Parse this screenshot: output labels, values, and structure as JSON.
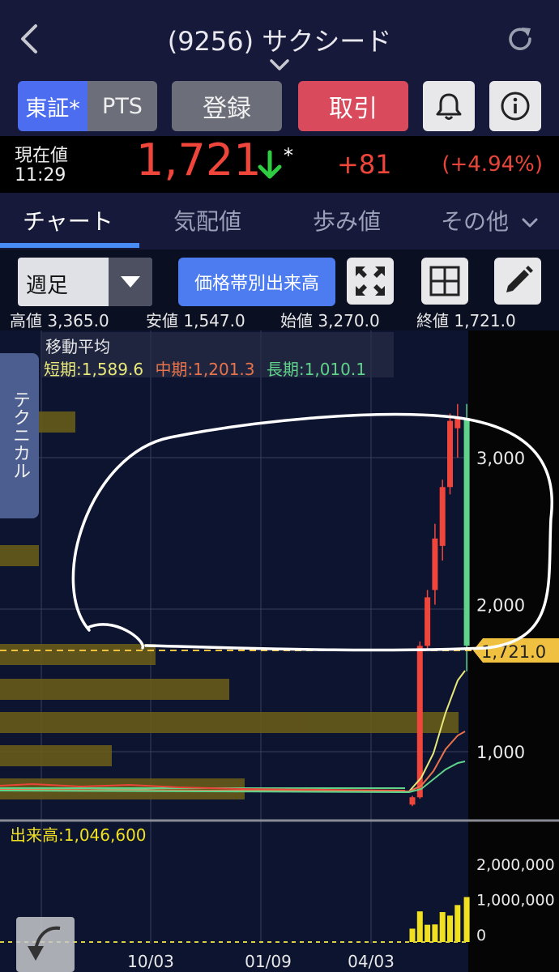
{
  "header": {
    "title": "(9256) サクシード"
  },
  "toolbar": {
    "market_tosho": "東証*",
    "market_pts": "PTS",
    "register": "登録",
    "trade": "取引"
  },
  "price": {
    "label": "現在値",
    "time": "11:29",
    "value": "1,721",
    "star": "*",
    "change": "+81",
    "change_pct": "(+4.94%)",
    "down_color": "#2ecc40",
    "up_color": "#f0453a"
  },
  "tabs": [
    {
      "label": "チャート",
      "active": true
    },
    {
      "label": "気配値"
    },
    {
      "label": "歩み値"
    },
    {
      "label": "その他"
    }
  ],
  "controls": {
    "period": "週足",
    "volume_profile": "価格帯別出来高"
  },
  "ohlc": {
    "high": "高値 3,365.0",
    "low": "安値 1,547.0",
    "open": "始値 3,270.0",
    "close": "終値 1,721.0"
  },
  "moving_average": {
    "title": "移動平均",
    "short": "短期:1,589.6",
    "mid": "中期:1,201.3",
    "long": "長期:1,010.1",
    "short_color": "#e8e87a",
    "mid_color": "#e8734a",
    "long_color": "#5fd38a"
  },
  "technical_tab": "テクニカル",
  "chart_data": {
    "type": "candlestick",
    "price_axis": {
      "ticks": [
        {
          "value": 3000,
          "label": "3,000"
        },
        {
          "value": 2000,
          "label": "2,000"
        },
        {
          "value": 1000,
          "label": "1,000"
        }
      ]
    },
    "current_price_label": "1,721.0",
    "current_price": 1721,
    "volume_label": "出来高:1,046,600",
    "volume_axis": {
      "ticks": [
        {
          "value": 2000000,
          "label": "2,000,000"
        },
        {
          "value": 1000000,
          "label": "1,000,000"
        },
        {
          "value": 0,
          "label": "0"
        }
      ]
    },
    "x_ticks": [
      "10/03",
      "01/09",
      "04/03"
    ],
    "recent_candles": [
      {
        "open": 640,
        "high": 700,
        "low": 630,
        "close": 690,
        "up": true
      },
      {
        "open": 690,
        "high": 1750,
        "low": 680,
        "close": 1720,
        "up": true
      },
      {
        "open": 1720,
        "high": 2100,
        "low": 1700,
        "close": 2050,
        "up": true
      },
      {
        "open": 2100,
        "high": 2550,
        "low": 2000,
        "close": 2450,
        "up": true
      },
      {
        "open": 2400,
        "high": 2850,
        "low": 2300,
        "close": 2800,
        "up": true
      },
      {
        "open": 2800,
        "high": 3300,
        "low": 2750,
        "close": 3250,
        "up": true
      },
      {
        "open": 3270,
        "high": 3365,
        "low": 3000,
        "close": 3200,
        "up": true
      },
      {
        "open": 3270,
        "high": 3365,
        "low": 1547,
        "close": 1721,
        "up": false
      }
    ],
    "recent_volumes": [
      150000,
      640000,
      260000,
      270000,
      620000,
      520000,
      820000,
      1046600
    ]
  }
}
